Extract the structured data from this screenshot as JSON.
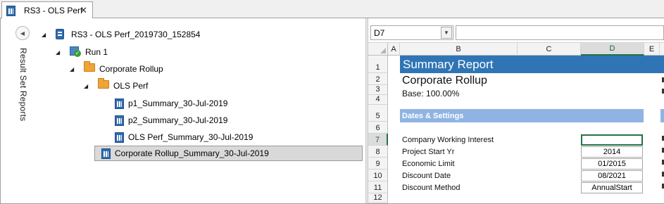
{
  "tab": {
    "title": "RS3 - OLS Perf",
    "close_glyph": "✕"
  },
  "side_panel": {
    "title": "Result Set Reports",
    "collapse_glyph": "◀"
  },
  "tree": {
    "nodes": [
      {
        "label": "RS3 - OLS Perf_2019730_152854",
        "icon": "result-set-icon",
        "expanded": true
      },
      {
        "label": "Run 1",
        "icon": "run-icon",
        "expanded": true
      },
      {
        "label": "Corporate Rollup",
        "icon": "folder-icon",
        "expanded": true
      },
      {
        "label": "OLS Perf",
        "icon": "folder-icon",
        "expanded": true
      },
      {
        "label": "p1_Summary_30-Jul-2019",
        "icon": "report-icon"
      },
      {
        "label": "p2_Summary_30-Jul-2019",
        "icon": "report-icon"
      },
      {
        "label": "OLS Perf_Summary_30-Jul-2019",
        "icon": "report-icon"
      },
      {
        "label": "Corporate Rollup_Summary_30-Jul-2019",
        "icon": "report-icon",
        "selected": true
      }
    ],
    "expander_glyph": "◢"
  },
  "sheet": {
    "name_box": "D7",
    "formula": "",
    "columns": [
      "A",
      "B",
      "C",
      "D",
      "E"
    ],
    "selected_column": "D",
    "rows": [
      "1",
      "2",
      "3",
      "4",
      "5",
      "6",
      "7",
      "8",
      "9",
      "10",
      "11",
      "12"
    ],
    "selected_row": "7",
    "banner": "Summary Report",
    "report_title": "Corporate Rollup",
    "base": "Base: 100.00%",
    "section_title": "Dates & Settings",
    "fields": [
      {
        "label": "Company Working Interest",
        "value": ""
      },
      {
        "label": "Project Start Yr",
        "value": "2014"
      },
      {
        "label": "Economic Limit",
        "value": "01/2015"
      },
      {
        "label": "Discount Date",
        "value": "08/2021"
      },
      {
        "label": "Discount Method",
        "value": "AnnualStart"
      }
    ],
    "colors": {
      "banner": "#2f75b5",
      "section": "#8fb4e3",
      "selection": "#217346"
    }
  }
}
